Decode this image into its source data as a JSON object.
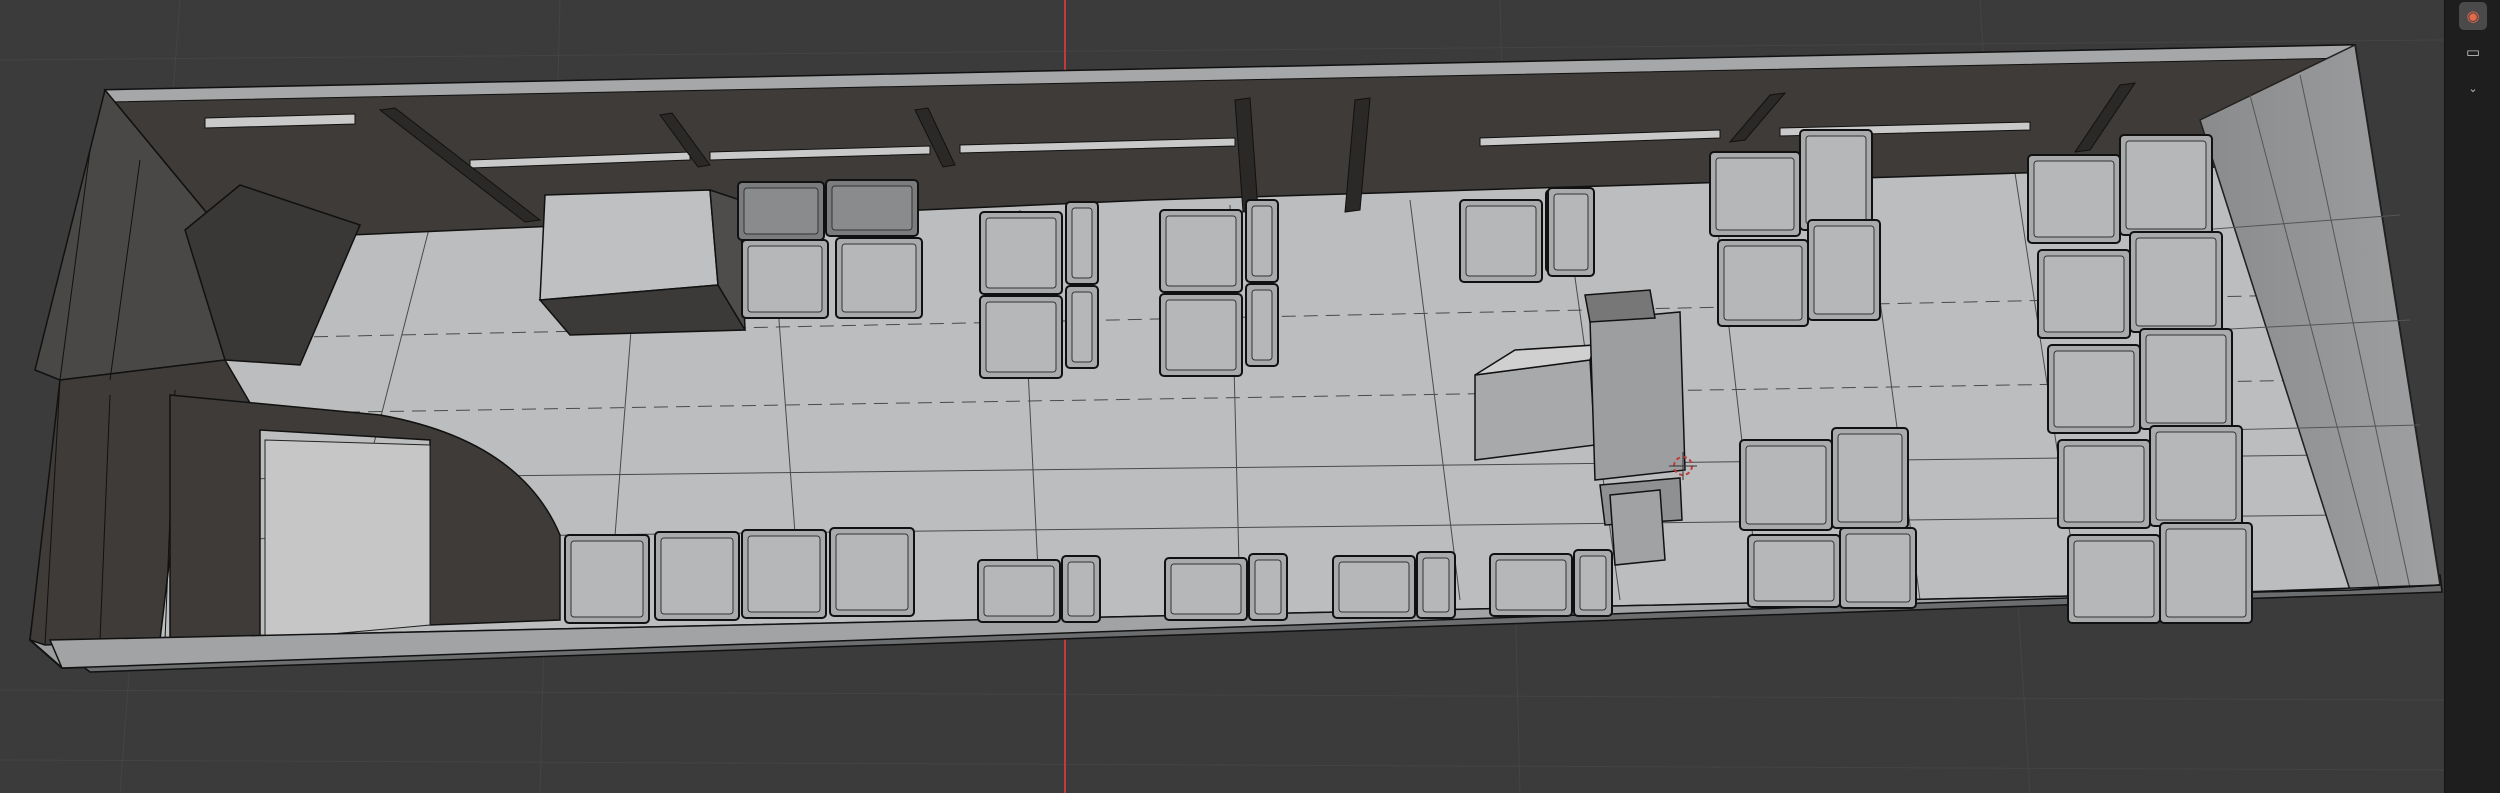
{
  "app": {
    "editor": "3D Viewport",
    "colors": {
      "background": "#3b3b3b",
      "grid": "#444444",
      "x_axis": "#c23b3b",
      "floor": "#bcbdbe",
      "wall_dark": "#3e3b38",
      "wall_side": "#5a5856",
      "rim": "#9c9d9e",
      "seat": "#a9aaab",
      "edge": "#111111"
    }
  },
  "side_strip": {
    "buttons": [
      {
        "icon": "scene-globe-icon",
        "active": true
      },
      {
        "icon": "archive-icon",
        "active": false
      },
      {
        "icon": "chevron-down-icon",
        "active": false
      }
    ]
  },
  "scene": {
    "object": "bus-interior-mesh",
    "cursor": "3d-cursor",
    "seats_top_row": 8,
    "seats_bottom_row": 9,
    "seat_rows_rear": 5
  }
}
